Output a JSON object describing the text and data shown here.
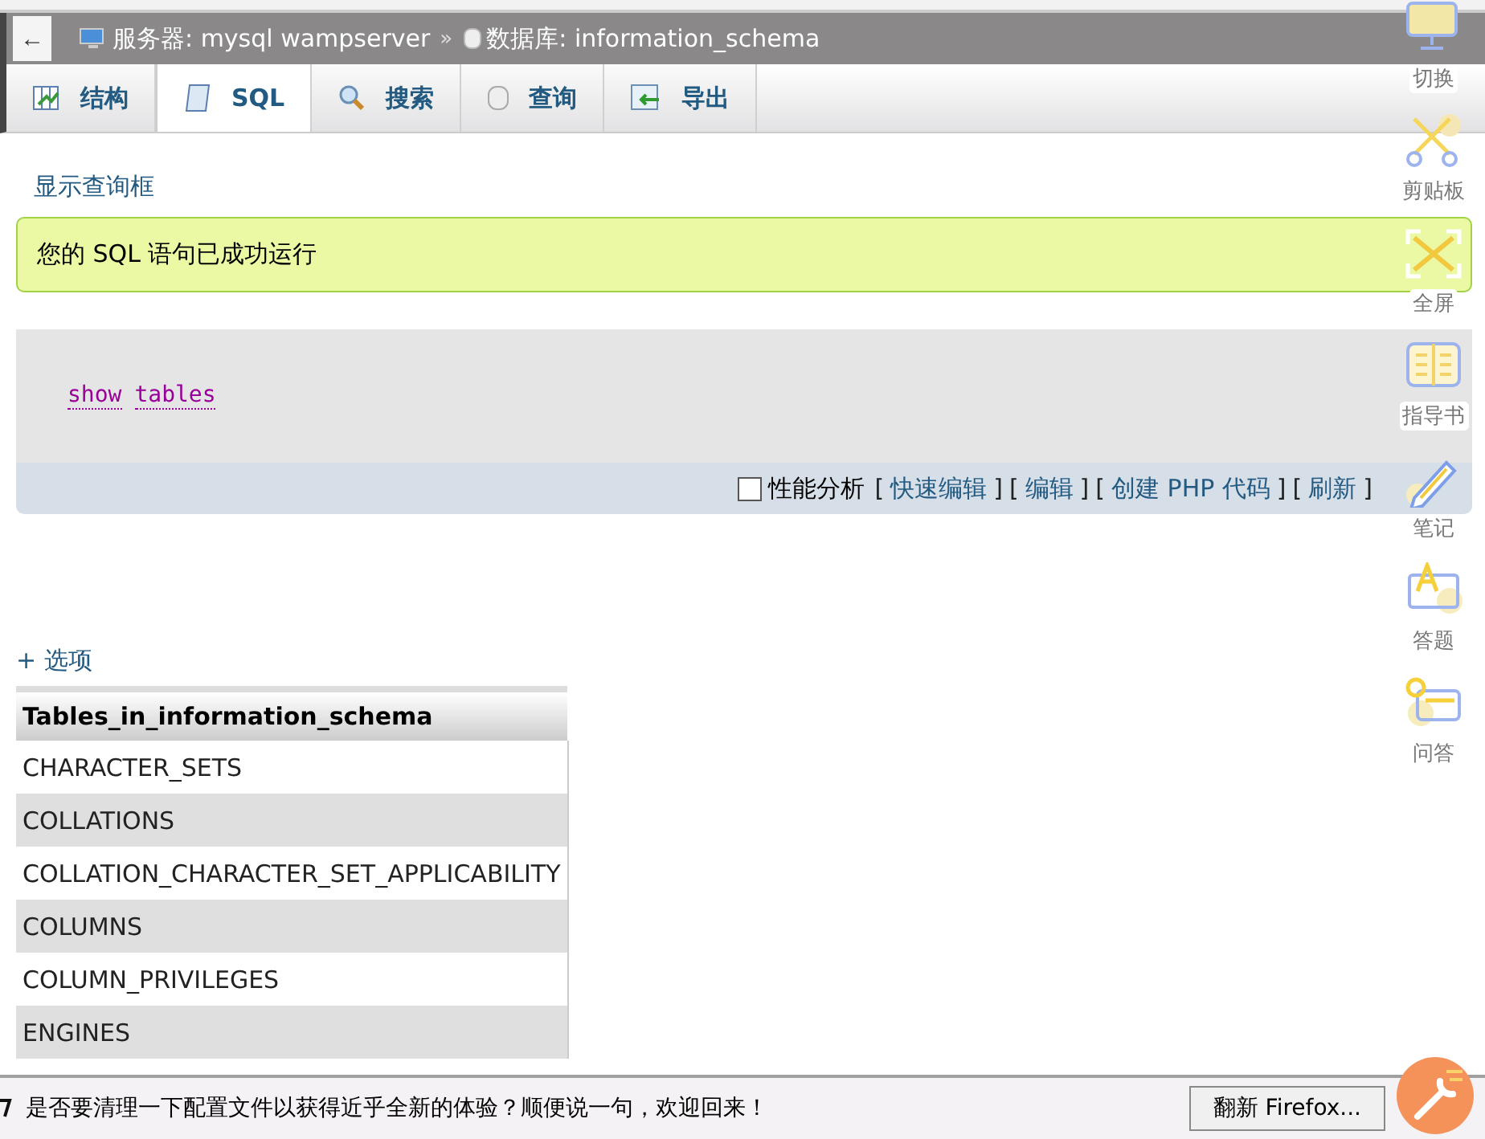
{
  "breadcrumb": {
    "back": "←",
    "server": "服务器: mysql wampserver",
    "separator": "»",
    "database": "数据库: information_schema"
  },
  "tabs": [
    {
      "label": "结构",
      "kind": "structure",
      "selected": false
    },
    {
      "label": "SQL",
      "kind": "sql",
      "selected": true
    },
    {
      "label": "搜索",
      "kind": "search",
      "selected": false
    },
    {
      "label": "查询",
      "kind": "query",
      "selected": false
    },
    {
      "label": "导出",
      "kind": "export",
      "selected": false
    }
  ],
  "show_query_link": "显示查询框",
  "success_message": "您的 SQL 语句已成功运行",
  "query": {
    "keywords": [
      "show",
      "tables"
    ]
  },
  "query_actions": {
    "profiling": {
      "label": "性能分析",
      "checked": false
    },
    "links": [
      {
        "open": "[",
        "text": "快速编辑",
        "close": "]"
      },
      {
        "open": "[",
        "text": "编辑",
        "close": "]"
      },
      {
        "open": "[",
        "text": "创建 PHP 代码",
        "close": "]"
      },
      {
        "open": "[",
        "text": "刷新",
        "close": "]"
      }
    ]
  },
  "options_link": "+ 选项",
  "table": {
    "column": "Tables_in_information_schema",
    "rows": [
      "CHARACTER_SETS",
      "COLLATIONS",
      "COLLATION_CHARACTER_SET_APPLICABILITY",
      "COLUMNS",
      "COLUMN_PRIVILEGES",
      "ENGINES"
    ]
  },
  "side_tools": [
    {
      "label": "切换",
      "kind": "monitor"
    },
    {
      "label": "剪贴板",
      "kind": "scissors"
    },
    {
      "label": "全屏",
      "kind": "fullscreen"
    },
    {
      "label": "指导书",
      "kind": "book"
    },
    {
      "label": "笔记",
      "kind": "pencil"
    },
    {
      "label": "答题",
      "kind": "answer"
    },
    {
      "label": "问答",
      "kind": "qa"
    }
  ],
  "notification": {
    "message": "是否要清理一下配置文件以获得近乎全新的体验？顺便说一句，欢迎回来！",
    "button": "翻新 Firefox..."
  }
}
